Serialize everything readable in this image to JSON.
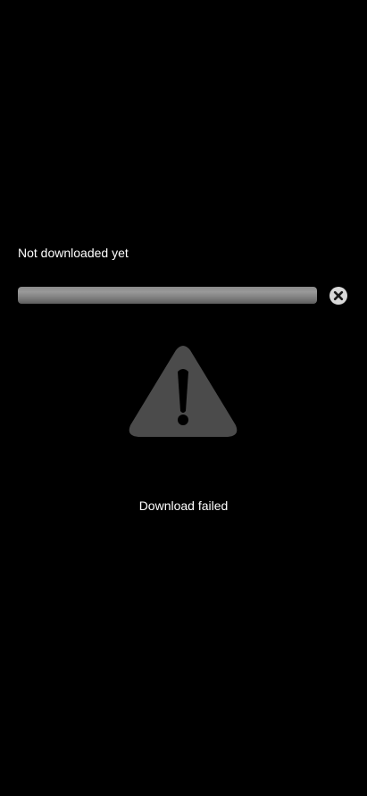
{
  "download": {
    "status_label": "Not downloaded yet",
    "progress_fraction": 1.0,
    "cancel_icon": "close-circle-icon",
    "warning_icon": "warning-triangle-icon",
    "message": "Download failed"
  },
  "colors": {
    "background": "#000000",
    "text": "#ffffff",
    "progress_bar": "#8a8a8a",
    "warning_icon": "#4a4a4a"
  }
}
